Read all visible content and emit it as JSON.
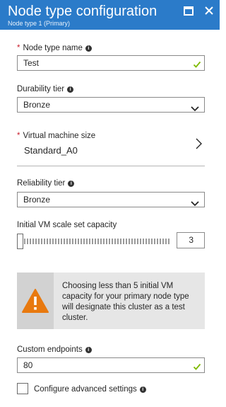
{
  "header": {
    "title": "Node type configuration",
    "subtitle": "Node type 1 (Primary)",
    "background_color": "#2b7bc9",
    "maximize_icon": "maximize-icon",
    "close_icon": "close-icon"
  },
  "node_type_name": {
    "required_mark": "*",
    "label": "Node type name",
    "value": "Test",
    "valid": true
  },
  "durability_tier": {
    "label": "Durability tier",
    "selected": "Bronze"
  },
  "vm_size": {
    "required_mark": "*",
    "label": "Virtual machine size",
    "value": "Standard_A0"
  },
  "reliability_tier": {
    "label": "Reliability tier",
    "selected": "Bronze"
  },
  "scale_set_capacity": {
    "label": "Initial VM scale set capacity",
    "value": "3",
    "fraction": 0.0
  },
  "warning": {
    "icon": "warning-icon",
    "icon_color": "#e8790f",
    "text": "Choosing less than 5 initial VM capacity for your primary node type will designate this cluster as a test cluster."
  },
  "custom_endpoints": {
    "label": "Custom endpoints",
    "value": "80",
    "valid": true
  },
  "advanced": {
    "label": "Configure advanced settings",
    "checked": false
  },
  "colors": {
    "valid_check": "#7fba00",
    "required": "#c9202f"
  }
}
